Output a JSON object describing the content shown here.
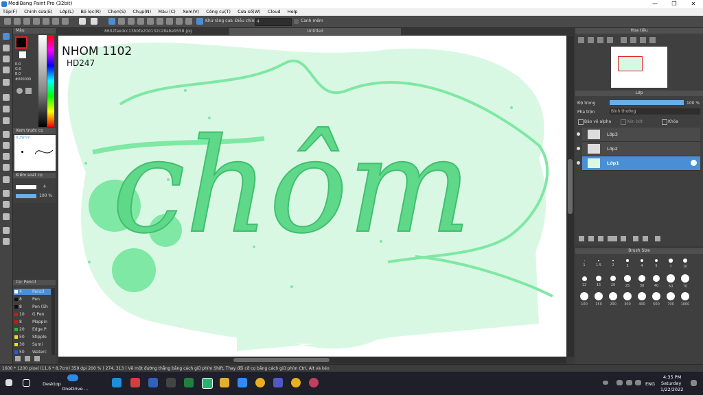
{
  "window": {
    "title": "MediBang Paint Pro (32bit)",
    "minimize": "—",
    "maximize": "❐",
    "close": "✕"
  },
  "menu": [
    "Tệp(F)",
    "Chỉnh sửa(E)",
    "Lớp(L)",
    "Bộ lọc(R)",
    "Chọn(S)",
    "Chụp(N)",
    "Màu (C)",
    "Xem(V)",
    "Công cụ(T)",
    "Cửa sổ(W)",
    "Cloud",
    "Help"
  ],
  "toolbar": {
    "antialias_label": "Khử răng cưa",
    "adjust_label": "Điều chỉnh",
    "adjust_value": "4",
    "smooth_label": "Canh mềm"
  },
  "color_panel": {
    "title": "Màu",
    "r": "R:0",
    "g": "G:0",
    "b": "B:0",
    "hex": "#000000"
  },
  "brush_preview": {
    "title": "Xem trước cọ",
    "size": "0.29mm"
  },
  "brush_control": {
    "title": "Kiểm soát cọ",
    "size_value": "4",
    "opacity_value": "100 %"
  },
  "brush_list": {
    "title": "Cọ: Pencil",
    "items": [
      {
        "size": "4",
        "name": "Pencil",
        "color": "#ffffff"
      },
      {
        "size": "8",
        "name": "Pen",
        "color": "#111111"
      },
      {
        "size": "8",
        "name": "Pen (Sh",
        "color": "#111111"
      },
      {
        "size": "10",
        "name": "G Pen",
        "color": "#e01010"
      },
      {
        "size": "8",
        "name": "Mappin",
        "color": "#e01010"
      },
      {
        "size": "20",
        "name": "Edge P",
        "color": "#20c020"
      },
      {
        "size": "50",
        "name": "Stipple",
        "color": "#e0e020"
      },
      {
        "size": "30",
        "name": "Sumi",
        "color": "#e0e020"
      },
      {
        "size": "50",
        "name": "Waterc",
        "color": "#2060e0"
      }
    ]
  },
  "tabs": {
    "file": "8602fae4cc13bbfe20d132c28abe9558.jpg",
    "untitled": "Untitled"
  },
  "canvas": {
    "note_top": "NHOM 1102",
    "note_bottom": "HD247",
    "lettering": "chôm"
  },
  "navigator": {
    "title": "Hoa tiêu"
  },
  "layers": {
    "title": "Lớp",
    "opacity_label": "Độ trong",
    "opacity_value": "100 %",
    "blend_label": "Pha trộn",
    "blend_value": "Bình thường",
    "protect_alpha": "Bảo vệ alpha",
    "clipping": "Xén bớt",
    "lock": "Khóa",
    "items": [
      {
        "name": "Lớp3"
      },
      {
        "name": "Lớp2"
      },
      {
        "name": "Lớp1",
        "selected": true
      }
    ]
  },
  "brush_size": {
    "title": "Brush Size",
    "sizes": [
      "1",
      "1.5",
      "2",
      "3",
      "4",
      "5",
      "7",
      "10",
      "12",
      "15",
      "20",
      "25",
      "30",
      "40",
      "50",
      "70",
      "100",
      "150",
      "200",
      "300",
      "400",
      "500",
      "700",
      "1000"
    ]
  },
  "status": {
    "text": "1600 * 1200 pixel   (11.6 * 8.7cm)   350 dpi   200 %   ( 274, 313 )   Vẽ một đường thẳng bằng cách giữ phím Shift, Thay đổi cỡ cọ bằng cách giữ phím Ctrl, Alt và kéo"
  },
  "taskbar": {
    "desktop": "Desktop",
    "onedrive": "OneDrive ...",
    "lang": "ENG",
    "time": "4:35 PM",
    "day": "Saturday",
    "date": "1/22/2022"
  },
  "colors": {
    "accent": "#4a8fd6",
    "mint": "#7ee8a4",
    "mint_light": "#d9f8e3"
  }
}
